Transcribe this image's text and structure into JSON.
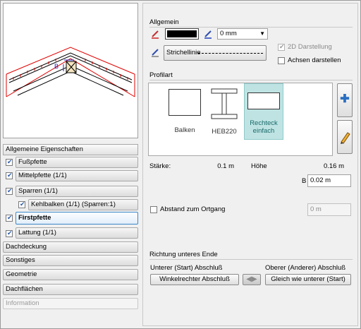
{
  "nav": {
    "header": "Allgemeine Eigenschaften",
    "items": [
      {
        "label": "Fußpfette",
        "checked": true
      },
      {
        "label": "Mittelpfette (1/1)",
        "checked": true
      },
      {
        "label": "Sparren (1/1)",
        "checked": true
      },
      {
        "label": "Kehlbalken (1/1) (Sparren:1)",
        "checked": true
      },
      {
        "label": "Firstpfette",
        "checked": true,
        "selected": true
      },
      {
        "label": "Lattung (1/1)",
        "checked": true
      }
    ],
    "sections": [
      "Dachdeckung",
      "Sonstiges",
      "Geometrie",
      "Dachflächen",
      "Information"
    ]
  },
  "general": {
    "title": "Allgemein",
    "pen_value": "0 mm",
    "line_style_label": "Strichellinie",
    "opt_2d_label": "2D Darstellung",
    "opt_axes_label": "Achsen darstellen",
    "line_color": "#000000"
  },
  "profile": {
    "title": "Profilart",
    "items": [
      {
        "label": "Balken"
      },
      {
        "label": "HEB220"
      },
      {
        "label": "Rechteck einfach",
        "selected": true
      }
    ],
    "thickness_label": "Stärke:",
    "thickness_value": "0.1 m",
    "height_label": "Höhe",
    "height_value": "0.16 m",
    "b_label": "B",
    "b_value": "0.02 m",
    "ortgang_label": "Abstand zum Ortgang",
    "ortgang_value": "0 m"
  },
  "direction": {
    "title": "Richtung unteres Ende",
    "start_label": "Unterer (Start) Abschluß",
    "end_label": "Oberer (Anderer) Abschluß",
    "start_button": "Winkelrechter Abschluß",
    "end_button": "Gleich wie unterer (Start)"
  },
  "preview": {
    "label_b": "B"
  },
  "colors": {
    "accent": "#3b87c7",
    "selected_profile": "#bfe3e3",
    "roof_red": "#e00000"
  }
}
